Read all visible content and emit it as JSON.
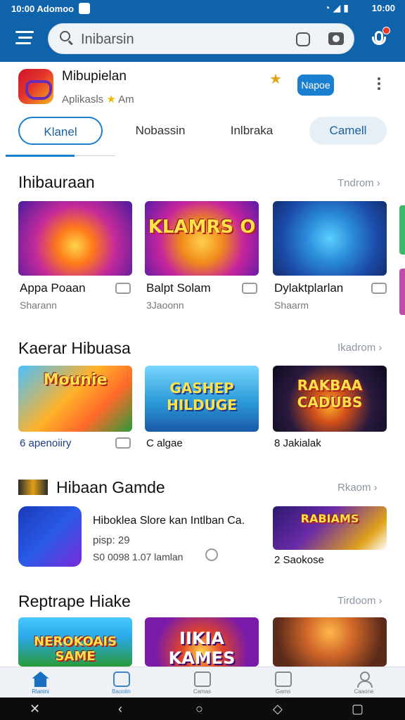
{
  "status": {
    "time": "10:00",
    "carrier": "Adomoo",
    "clock_right": "10:00"
  },
  "search": {
    "placeholder": "Inibarsin"
  },
  "app": {
    "name": "Mibupielan",
    "subtitle": "Aplikasls",
    "subtitle_suffix": "Am",
    "action_label": "Napoe"
  },
  "tabs": [
    {
      "label": "Klanel",
      "state": "active"
    },
    {
      "label": "Nobassin",
      "state": "normal"
    },
    {
      "label": "Inlbraka",
      "state": "normal"
    },
    {
      "label": "Camell",
      "state": "filled"
    }
  ],
  "sections": [
    {
      "title": "Ihibauraan",
      "link": "Tndrom",
      "games": [
        {
          "title": "Appa Poaan",
          "sub": "Sharann",
          "art": "Party crew"
        },
        {
          "title": "Balpt Solam",
          "sub": "3Jaoonn",
          "art": "KLAMRS O"
        },
        {
          "title": "Dylaktplarlan",
          "sub": "Shaarm",
          "art": "Heroes"
        }
      ]
    },
    {
      "title": "Kaerar Hibuasa",
      "link": "Ikadrom",
      "games": [
        {
          "title": "6 apenoiiry",
          "sub": "",
          "art": "Mounie"
        },
        {
          "title": "C algae",
          "sub": "",
          "art": "GASHEP HILDUGE"
        },
        {
          "title": "8 Jakialak",
          "sub": "",
          "art": "RAKBAA CADUBS"
        }
      ]
    },
    {
      "title": "Hibaan Gamde",
      "link": "Rkaom",
      "featured": {
        "title": "Hiboklea Slore kan Intlban Ca.",
        "price": "pisp: 29",
        "meta": "S0 0098 1.07 lamlan"
      },
      "side_game": {
        "title": "2 Saokose",
        "art": "RABIAMS"
      }
    },
    {
      "title": "Reptrape Hiake",
      "link": "Tirdoom",
      "games": [
        {
          "title": "",
          "sub": "",
          "art": "NEROKOAIS SAME"
        },
        {
          "title": "",
          "sub": "",
          "art": "IIKIA KAMES"
        },
        {
          "title": "",
          "sub": "",
          "art": ""
        }
      ]
    }
  ],
  "bottom_nav": [
    {
      "label": "Rlanini",
      "icon": "home-icon",
      "active": true
    },
    {
      "label": "Baoolin",
      "icon": "chat-icon",
      "active": false
    },
    {
      "label": "Camas",
      "icon": "apps-icon",
      "active": false
    },
    {
      "label": "Gams",
      "icon": "dice-icon",
      "active": false
    },
    {
      "label": "Caaone",
      "icon": "user-icon",
      "active": false
    }
  ]
}
